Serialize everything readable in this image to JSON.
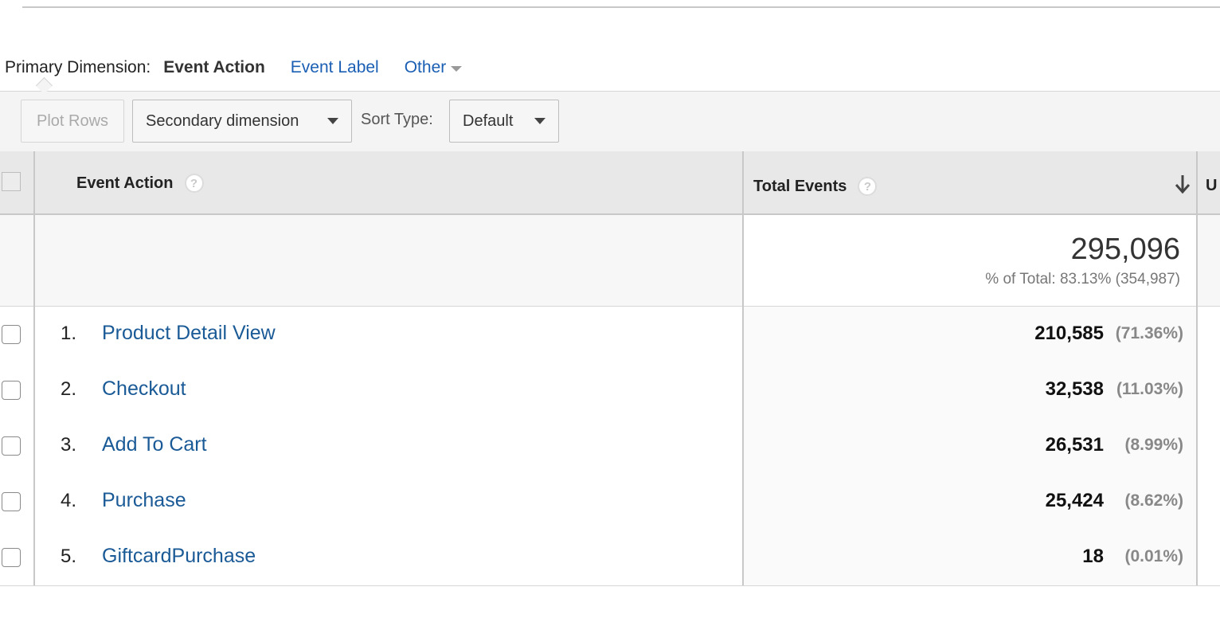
{
  "primary_dimension": {
    "label": "Primary Dimension:",
    "active": "Event Action",
    "links": [
      "Event Label"
    ],
    "other": "Other"
  },
  "toolbar": {
    "plot_rows": "Plot Rows",
    "secondary_dimension": "Secondary dimension",
    "sort_type_label": "Sort Type:",
    "sort_type_value": "Default"
  },
  "table": {
    "dimension_header": "Event Action",
    "metric_header": "Total Events",
    "next_header_partial": "U",
    "help_glyph": "?",
    "total": {
      "value": "295,096",
      "sub": "% of Total: 83.13% (354,987)"
    },
    "rows": [
      {
        "index": "1.",
        "name": "Product Detail View",
        "value": "210,585",
        "pct": "(71.36%)"
      },
      {
        "index": "2.",
        "name": "Checkout",
        "value": "32,538",
        "pct": "(11.03%)"
      },
      {
        "index": "3.",
        "name": "Add To Cart",
        "value": "26,531",
        "pct": "(8.99%)"
      },
      {
        "index": "4.",
        "name": "Purchase",
        "value": "25,424",
        "pct": "(8.62%)"
      },
      {
        "index": "5.",
        "name": "GiftcardPurchase",
        "value": "18",
        "pct": "(0.01%)"
      }
    ]
  },
  "colors": {
    "link": "#1a5a96",
    "tab_link": "#1a5fb4",
    "header_bg": "#e8e8e8",
    "toolbar_bg": "#f4f4f4"
  },
  "icons": {
    "sort": "arrow-down-icon",
    "help": "help-icon",
    "dropdown": "chevron-down-icon"
  }
}
